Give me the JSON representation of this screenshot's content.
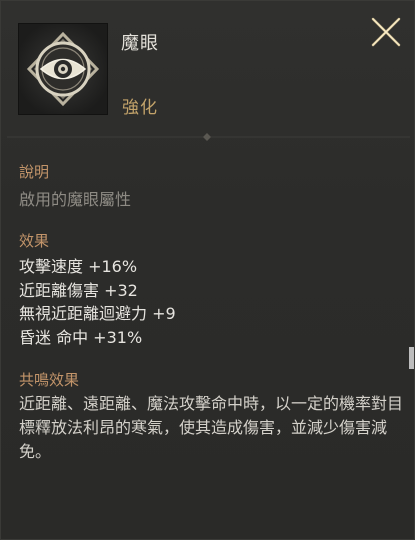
{
  "skill": {
    "icon": "eye-emblem-icon",
    "name": "魔眼",
    "grade": "強化"
  },
  "sections": {
    "description_label": "說明",
    "description_text": "啟用的魔眼屬性",
    "effect_label": "效果",
    "effects": [
      "攻擊速度 +16%",
      "近距離傷害 +32",
      "無視近距離迴避力 +9",
      "昏迷 命中 +31%"
    ],
    "resonance_label": "共鳴效果",
    "resonance_text": "近距離、遠距離、魔法攻擊命中時，以一定的機率對目標釋放法利昂的寒氣，使其造成傷害，並減少傷害減免。"
  },
  "colors": {
    "background": "#2b2b29",
    "title": "#e4e1da",
    "grade": "#c3a36a",
    "section_label": "#c3956a",
    "description": "#8e8b84",
    "stat": "#e6e4df"
  }
}
